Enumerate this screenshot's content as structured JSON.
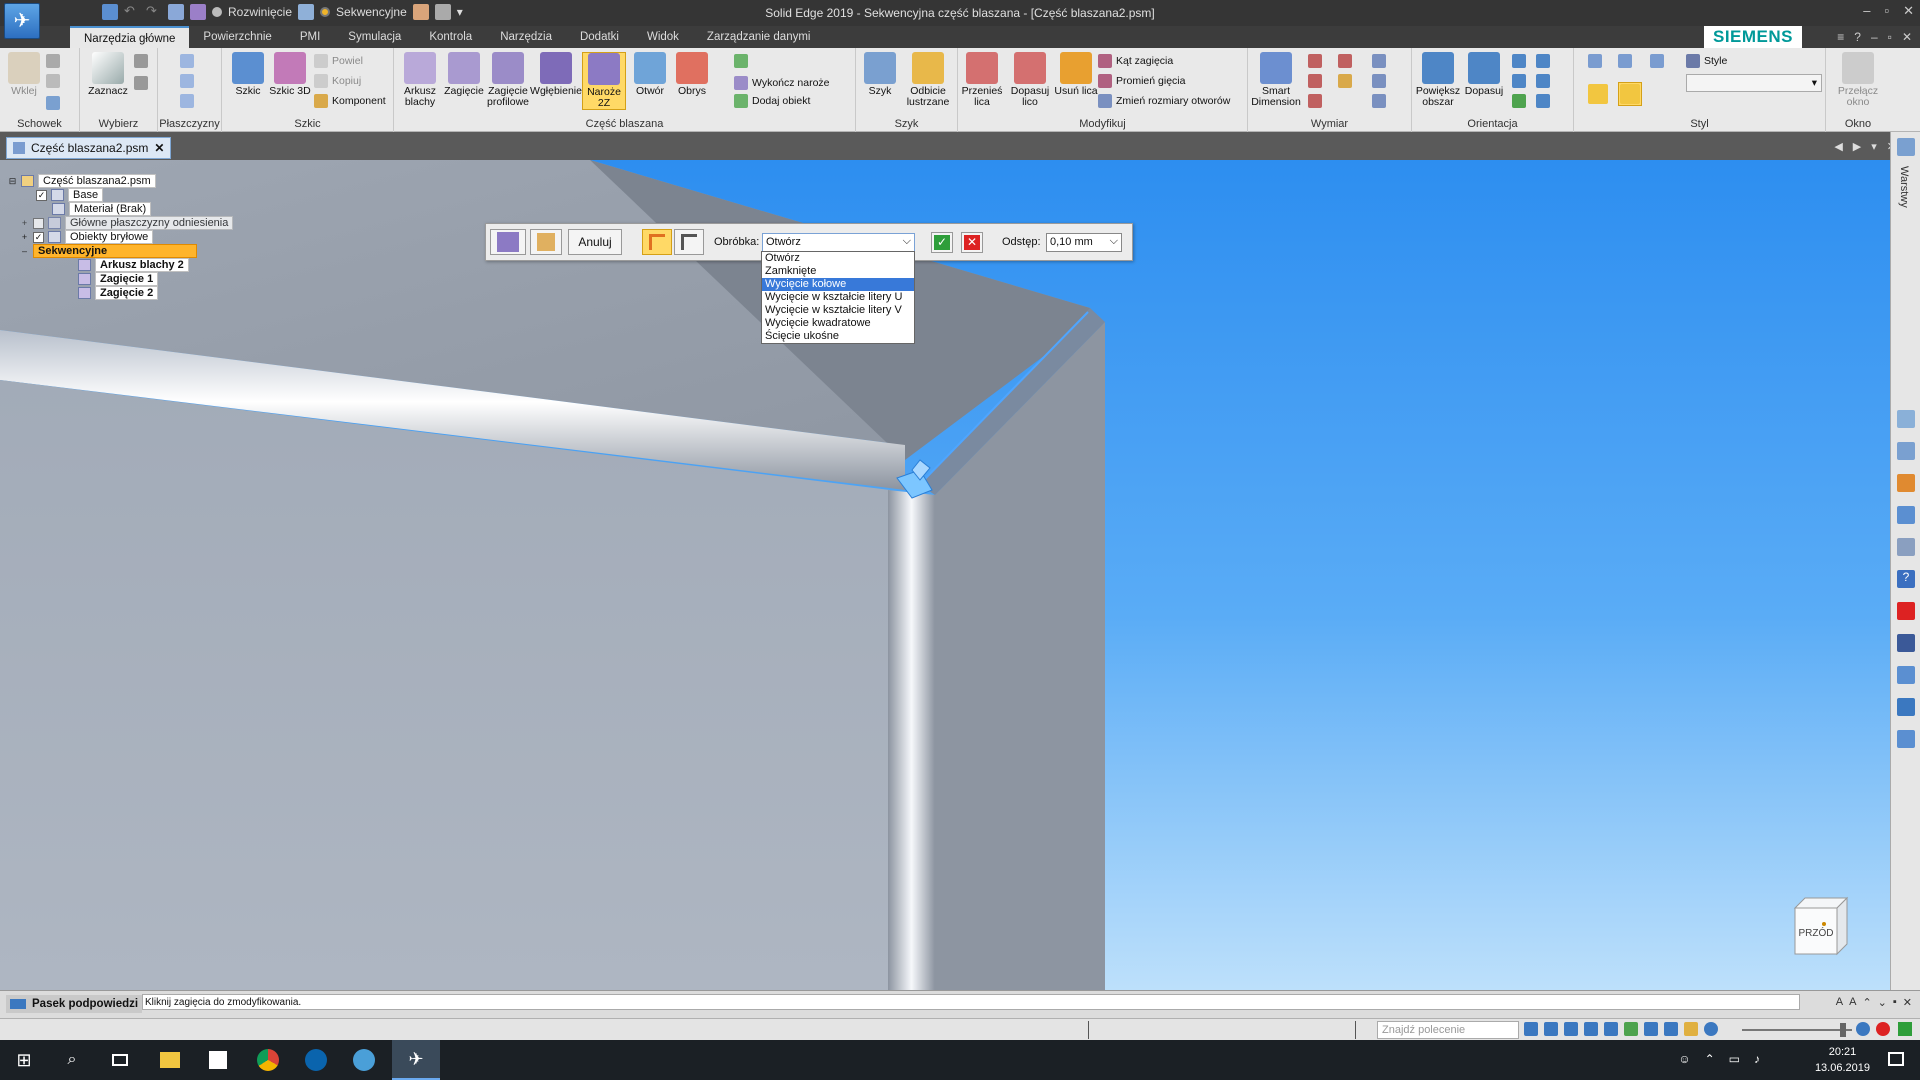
{
  "window": {
    "title": "Solid Edge 2019 - Sekwencyjna część blaszana - [Część blaszana2.psm]"
  },
  "qat": {
    "mode1": "Rozwinięcie",
    "mode2": "Sekwencyjne"
  },
  "ribbon_tabs": [
    "Narzędzia główne",
    "Powierzchnie",
    "PMI",
    "Symulacja",
    "Kontrola",
    "Narzędzia",
    "Dodatki",
    "Widok",
    "Zarządzanie danymi"
  ],
  "brand": "SIEMENS",
  "ribbon": {
    "groups": [
      "Schowek",
      "Wybierz",
      "Płaszczyzny",
      "Szkic",
      "Część blaszana",
      "Szyk",
      "Modyfikuj",
      "Wymiar",
      "Orientacja",
      "Styl",
      "Okno"
    ],
    "wklej": "Wklej",
    "zaznacz": "Zaznacz",
    "szkic": "Szkic",
    "szkic3d": "Szkic 3D",
    "powiel": "Powiel",
    "kopiuj": "Kopiuj",
    "komponent": "Komponent",
    "arkusz": "Arkusz blachy",
    "zagiecie": "Zagięcie",
    "zagiecie_profilowe": "Zagięcie profilowe",
    "wglebienie": "Wgłębienie",
    "naroze": "Naroże 2Z",
    "otwor": "Otwór",
    "obrys": "Obrys",
    "wykoncz": "Wykończ naroże",
    "dodaj": "Dodaj obiekt",
    "szyk": "Szyk",
    "odbicie": "Odbicie lustrzane",
    "przenies": "Przenieś lica",
    "dopasuj": "Dopasuj lico",
    "usun": "Usuń lica",
    "kat": "Kąt zagięcia",
    "promien": "Promień gięcia",
    "zmien": "Zmień rozmiary otworów",
    "smart": "Smart Dimension",
    "powieksz": "Powiększ obszar",
    "dopasuj2": "Dopasuj",
    "style": "Style",
    "przelacz": "Przełącz okno"
  },
  "doc_tab": "Część blaszana2.psm",
  "tree": {
    "root": "Część blaszana2.psm",
    "base": "Base",
    "material": "Materiał (Brak)",
    "planes": "Główne płaszczyzny odniesienia",
    "bodies": "Obiekty bryłowe",
    "sequential": "Sekwencyjne",
    "f1": "Arkusz blachy 2",
    "f2": "Zagięcie 1",
    "f3": "Zagięcie 2"
  },
  "command": {
    "cancel": "Anuluj",
    "treatment_label": "Obróbka:",
    "treatment_value": "Otwórz",
    "gap_label": "Odstęp:",
    "gap_value": "0,10 mm",
    "options": [
      "Otwórz",
      "Zamknięte",
      "Wycięcie kołowe",
      "Wycięcie w kształcie litery U",
      "Wycięcie w kształcie litery V",
      "Wycięcie kwadratowe",
      "Ścięcie ukośne"
    ],
    "highlighted": "Wycięcie kołowe"
  },
  "navcube": {
    "face": "PRZÓD"
  },
  "right_panel": "Warstwy",
  "prompt": {
    "title": "Pasek podpowiedzi",
    "text": "Kliknij zagięcia do zmodyfikowania."
  },
  "status": {
    "find_placeholder": "Znajdź polecenie"
  },
  "taskbar": {
    "time": "20:21",
    "date": "13.06.2019"
  },
  "colors": {
    "accent": "#3879d9",
    "highlight_orange": "#ffb42b",
    "ok": "#2e9e3a",
    "cancel": "#d22222",
    "viewport_top": "#2d8ef0"
  }
}
